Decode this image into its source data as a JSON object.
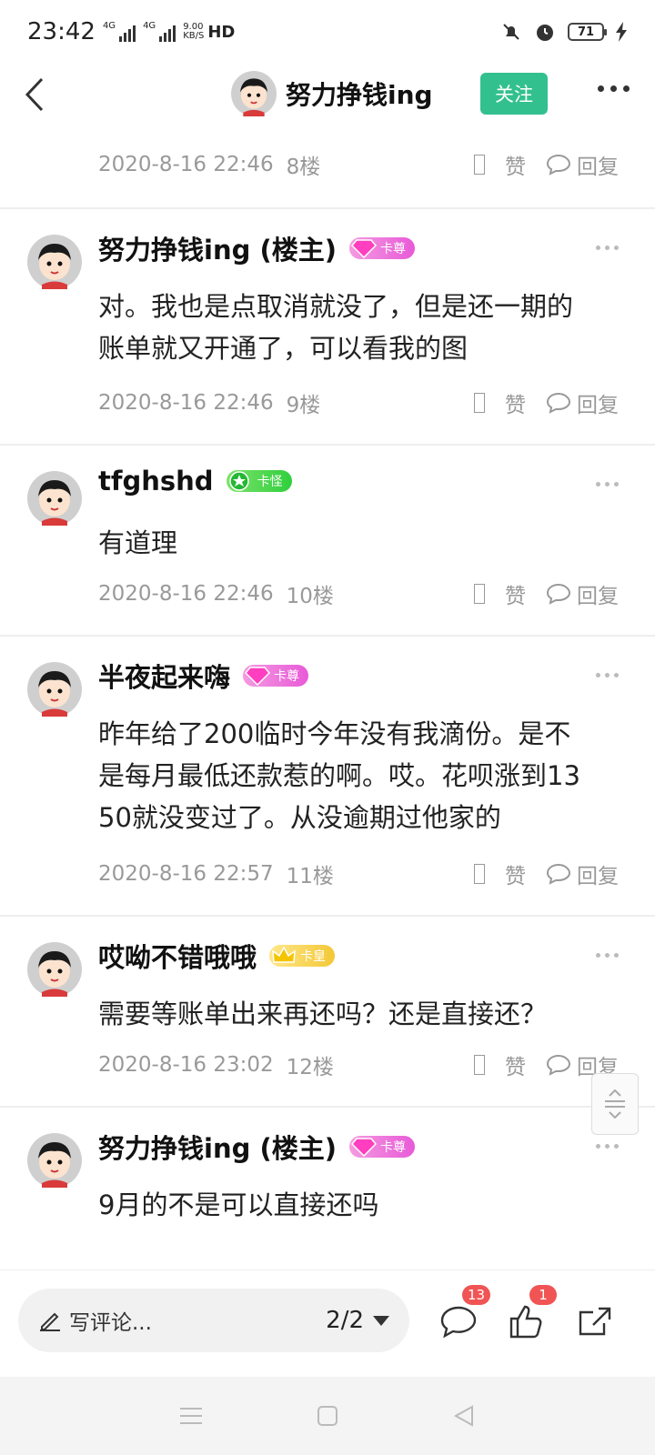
{
  "status_bar": {
    "time": "23:42",
    "network_1": "4G",
    "network_2": "4G",
    "speed_value": "9.00",
    "speed_unit": "KB/S",
    "hd": "HD",
    "battery": "71"
  },
  "header": {
    "author_name": "努力挣钱ing",
    "follow_label": "关注",
    "follow_color": "#33c08f"
  },
  "previous_meta": {
    "time": "2020-8-16 22:46",
    "floor": "8楼",
    "like_label": "赞",
    "reply_label": "回复"
  },
  "comments": [
    {
      "username": "努力挣钱ing (楼主)",
      "badge": "卡尊",
      "badge_color": "pink",
      "text_lines": [
        "对。我也是点取消就没了，但是还一期的",
        "账单就又开通了，可以看我的图"
      ],
      "time": "2020-8-16 22:46",
      "floor": "9楼",
      "like_label": "赞",
      "reply_label": "回复"
    },
    {
      "username": "tfghshd",
      "badge": "卡怪",
      "badge_color": "green",
      "text_lines": [
        "有道理"
      ],
      "time": "2020-8-16 22:46",
      "floor": "10楼",
      "like_label": "赞",
      "reply_label": "回复"
    },
    {
      "username": "半夜起来嗨",
      "badge": "卡尊",
      "badge_color": "pink",
      "text_lines": [
        "昨年给了200临时今年没有我滴份。是不",
        "是每月最低还款惹的啊。哎。花呗涨到13",
        "50就没变过了。从没逾期过他家的"
      ],
      "time": "2020-8-16 22:57",
      "floor": "11楼",
      "like_label": "赞",
      "reply_label": "回复"
    },
    {
      "username": "哎呦不错哦哦",
      "badge": "卡皇",
      "badge_color": "gold",
      "text_lines": [
        "需要等账单出来再还吗？还是直接还？"
      ],
      "time": "2020-8-16 23:02",
      "floor": "12楼",
      "like_label": "赞",
      "reply_label": "回复"
    },
    {
      "username": "努力挣钱ing (楼主)",
      "badge": "卡尊",
      "badge_color": "pink",
      "text_lines": [
        "9月的不是可以直接还吗"
      ]
    }
  ],
  "bottom_bar": {
    "compose_placeholder": "写评论...",
    "page_indicator": "2/2",
    "comment_count": "13",
    "like_count": "1"
  }
}
